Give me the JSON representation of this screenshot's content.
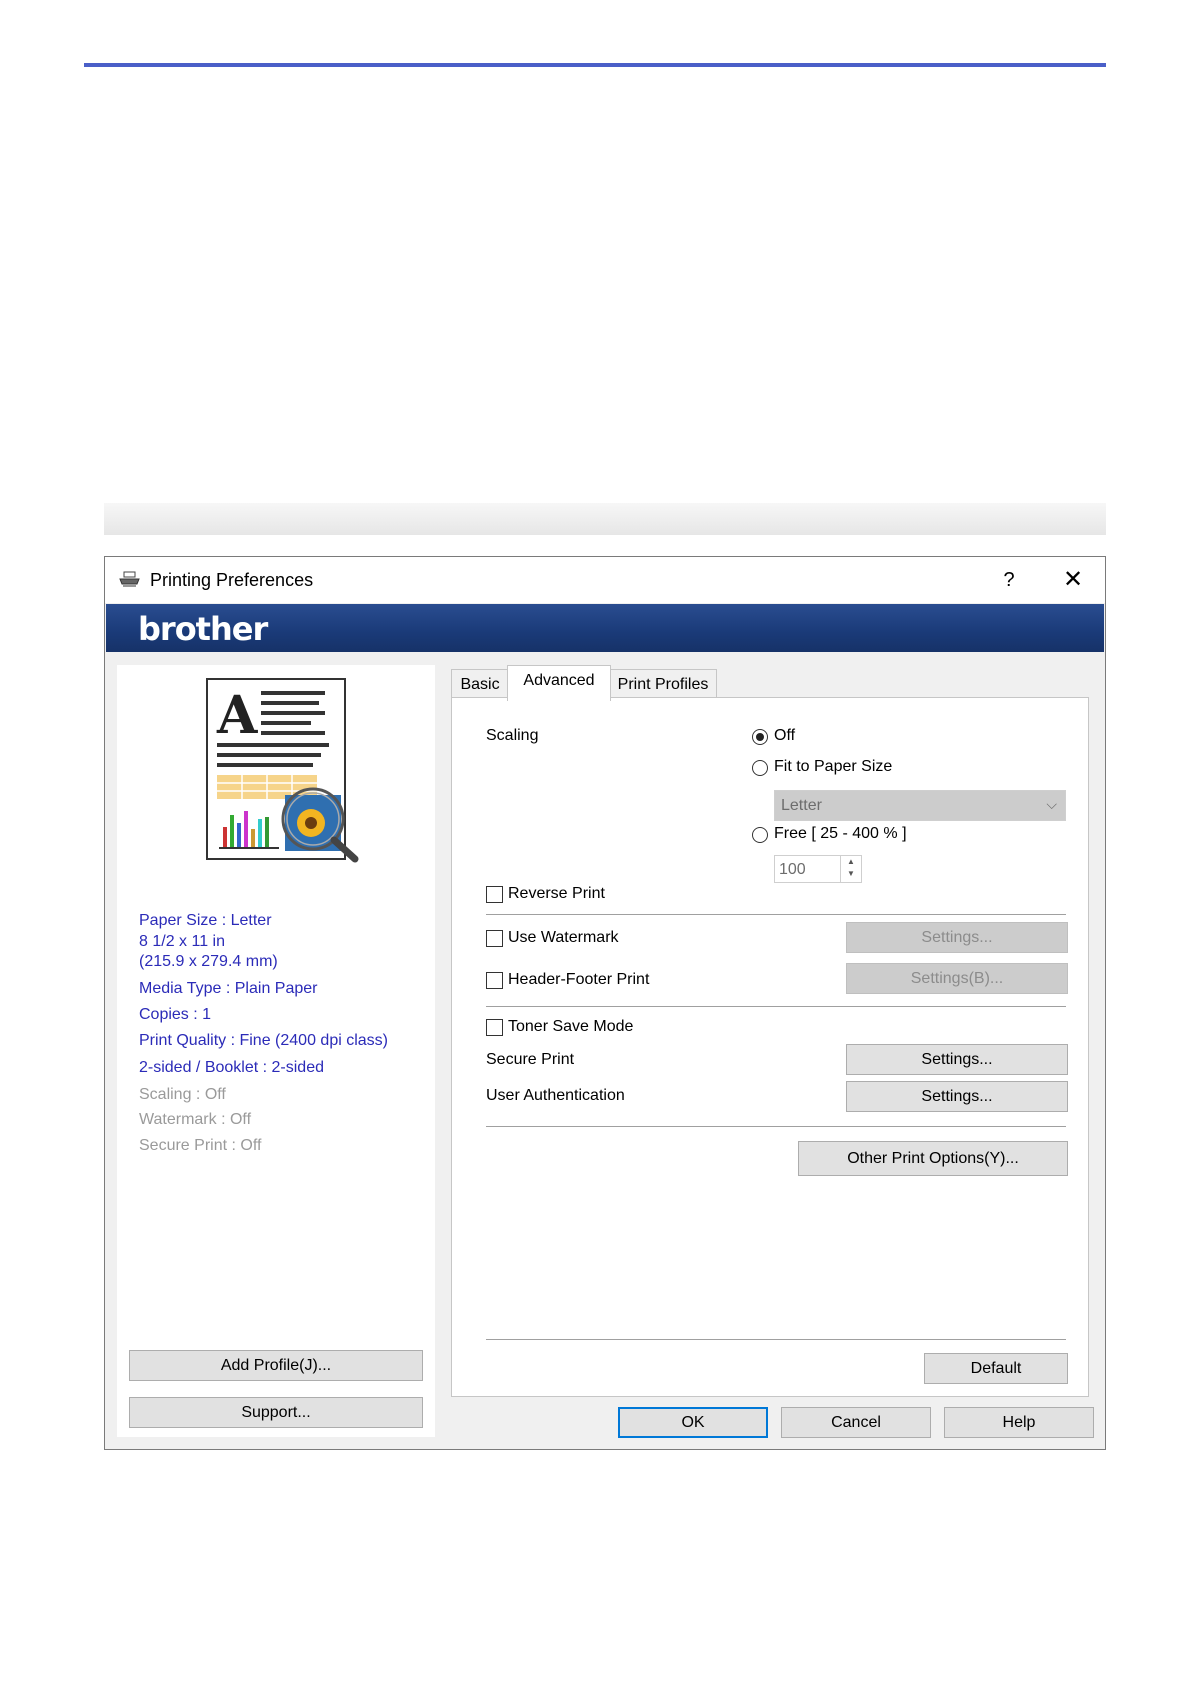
{
  "window": {
    "title": "Printing Preferences",
    "help_glyph": "?",
    "close_glyph": "✕",
    "brand": "brother"
  },
  "summary": {
    "paper_size": "Paper Size : Letter",
    "paper_dims_in": "8 1/2 x 11 in",
    "paper_dims_mm": "(215.9 x 279.4 mm)",
    "media_type": "Media Type : Plain Paper",
    "copies": "Copies : 1",
    "print_quality": "Print Quality : Fine (2400 dpi class)",
    "two_sided": "2-sided / Booklet : 2-sided",
    "scaling": "Scaling : Off",
    "watermark": "Watermark : Off",
    "secure_print": "Secure Print : Off"
  },
  "left_buttons": {
    "add_profile": "Add Profile(J)...",
    "support": "Support..."
  },
  "tabs": [
    {
      "label": "Basic",
      "active": false
    },
    {
      "label": "Advanced",
      "active": true
    },
    {
      "label": "Print Profiles",
      "active": false
    }
  ],
  "advanced": {
    "scaling_label": "Scaling",
    "scaling_options": [
      {
        "label": "Off",
        "selected": true
      },
      {
        "label": "Fit to Paper Size",
        "selected": false
      },
      {
        "label": "Free [ 25 - 400 % ]",
        "selected": false
      }
    ],
    "fit_paper_value": "Letter",
    "free_value": "100",
    "reverse_print": {
      "label": "Reverse Print",
      "checked": false
    },
    "use_watermark": {
      "label": "Use Watermark",
      "checked": false,
      "settings": "Settings..."
    },
    "header_footer": {
      "label": "Header-Footer Print",
      "checked": false,
      "settings": "Settings(B)..."
    },
    "toner_save": {
      "label": "Toner Save Mode",
      "checked": false
    },
    "secure_print": {
      "label": "Secure Print",
      "settings": "Settings..."
    },
    "user_auth": {
      "label": "User Authentication",
      "settings": "Settings..."
    },
    "other_options": "Other Print Options(Y)...",
    "default": "Default"
  },
  "footer_buttons": {
    "ok": "OK",
    "cancel": "Cancel",
    "help": "Help"
  },
  "icons": [
    "printer-icon",
    "help-icon",
    "close-icon",
    "document-preview-icon",
    "chevron-down-icon",
    "spin-up-icon",
    "spin-down-icon"
  ]
}
